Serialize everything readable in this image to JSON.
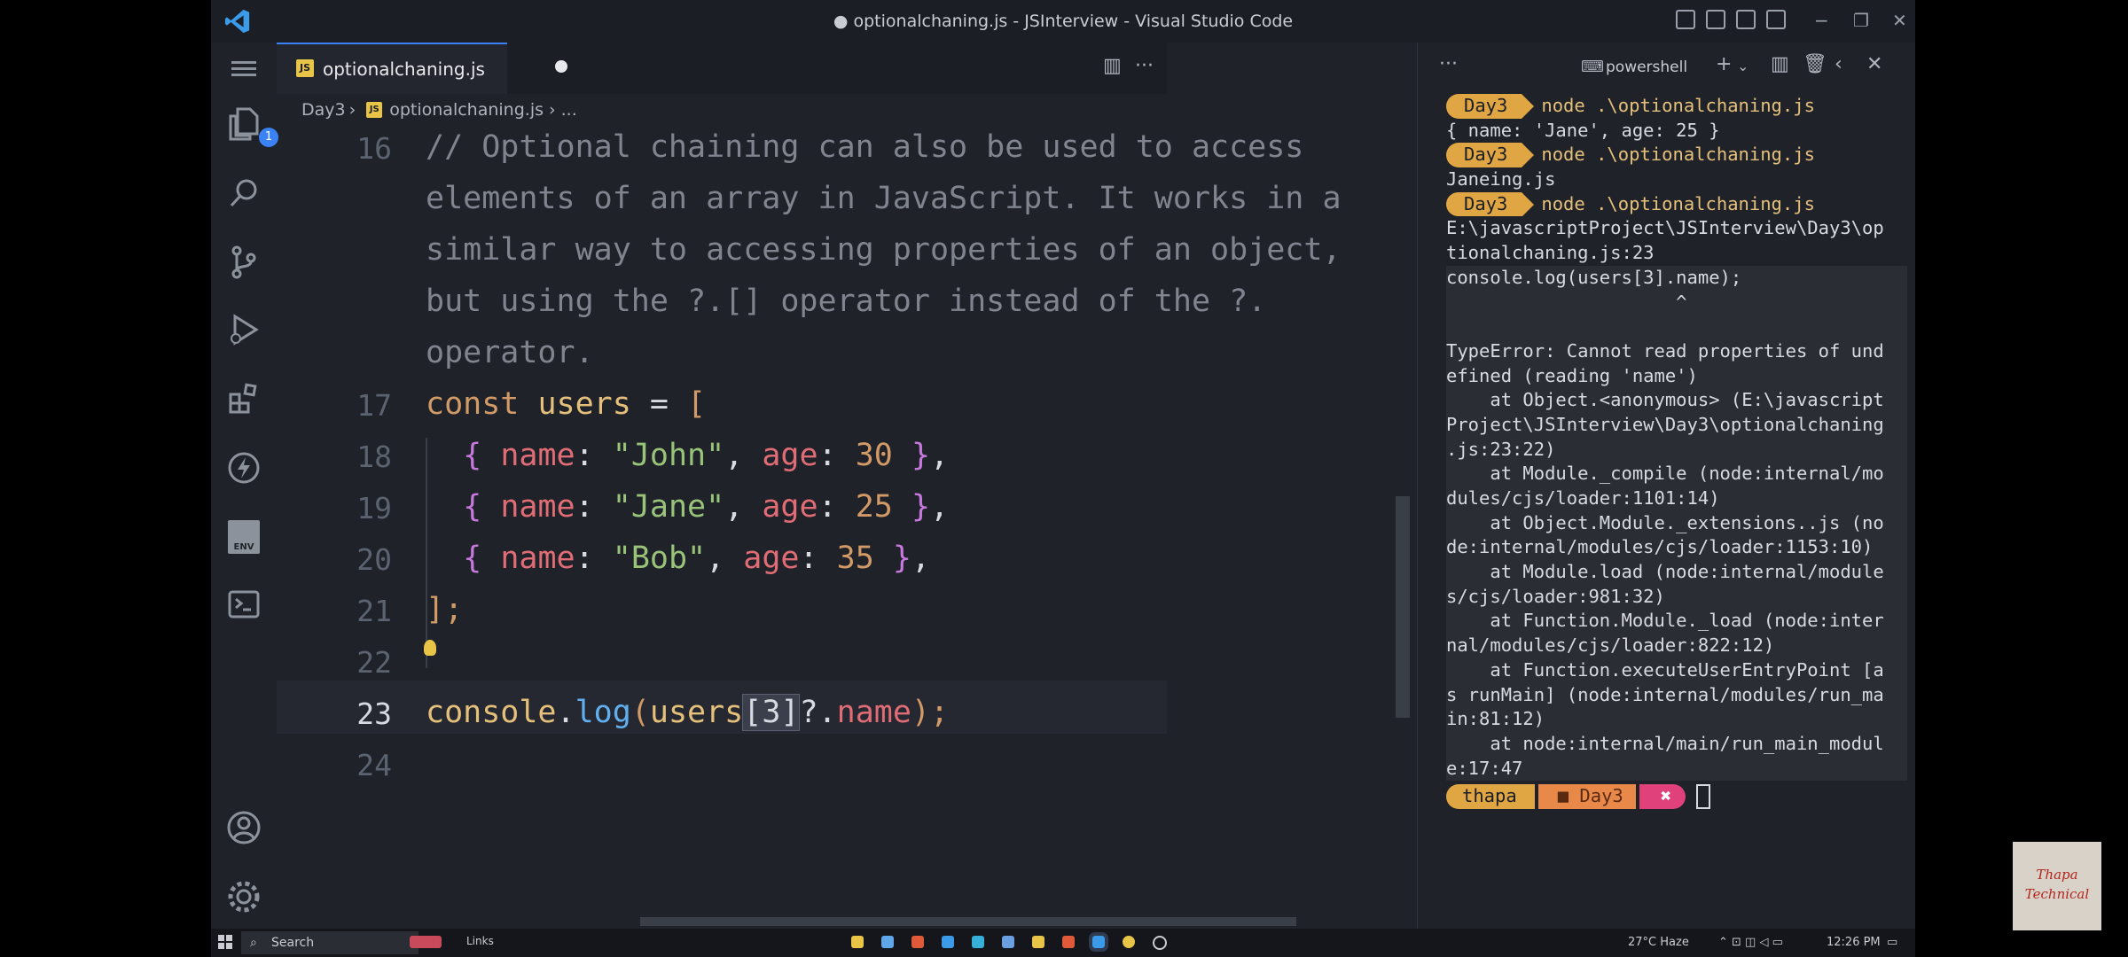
{
  "window": {
    "title": "● optionalchaning.js - JSInterview - Visual Studio Code"
  },
  "activity_bar": {
    "explorer_badge": "1",
    "env_label": "ENV"
  },
  "editor": {
    "tab_label": "optionalchaning.js",
    "breadcrumb": {
      "folder": "Day3",
      "file": "optionalchaning.js",
      "more": "..."
    },
    "line_numbers": [
      "16",
      "17",
      "18",
      "19",
      "20",
      "21",
      "22",
      "23",
      "24"
    ],
    "comment_lines": [
      "// Optional chaining can also be used to access",
      "elements of an array in JavaScript. It works in a",
      "similar way to accessing properties of an object,",
      "but using the ?.[] operator instead of the ?.",
      "operator."
    ],
    "code": {
      "const_kw": "const",
      "users_var": "users",
      "assign": " = ",
      "open_bracket": "[",
      "rows": [
        {
          "name_key": "name",
          "name_val": "\"John\"",
          "age_key": "age",
          "age_val": "30"
        },
        {
          "name_key": "name",
          "name_val": "\"Jane\"",
          "age_key": "age",
          "age_val": "25"
        },
        {
          "name_key": "name",
          "name_val": "\"Bob\"",
          "age_key": "age",
          "age_val": "35"
        }
      ],
      "close_bracket": "];",
      "l23_console": "console",
      "l23_dot": ".",
      "l23_log": "log",
      "l23_paren": "(",
      "l23_users": "users",
      "l23_index": "[3]",
      "l23_opt": "?.",
      "l23_name": "name",
      "l23_end": ");"
    }
  },
  "terminal": {
    "shell_label": "powershell",
    "lines": [
      {
        "prompt": "Day3",
        "text": "node .\\optionalchaning.js"
      },
      {
        "text": "{ name: 'Jane', age: 25 }"
      },
      {
        "prompt": "Day3",
        "text": "node .\\optionalchaning.js"
      },
      {
        "text": "Janeing.js"
      },
      {
        "prompt": "Day3",
        "text": "node .\\optionalchaning.js"
      },
      {
        "text": "E:\\javascriptProject\\JSInterview\\Day3\\op"
      },
      {
        "text": "tionalchaning.js:23"
      },
      {
        "text": "console.log(users[3].name);"
      },
      {
        "text": "                     ^"
      },
      {
        "text": ""
      },
      {
        "text": "TypeError: Cannot read properties of und"
      },
      {
        "text": "efined (reading 'name')"
      },
      {
        "text": "    at Object.<anonymous> (E:\\javascript"
      },
      {
        "text": "Project\\JSInterview\\Day3\\optionalchaning"
      },
      {
        "text": ".js:23:22)"
      },
      {
        "text": "    at Module._compile (node:internal/mo"
      },
      {
        "text": "dules/cjs/loader:1101:14)"
      },
      {
        "text": "    at Object.Module._extensions..js (no"
      },
      {
        "text": "de:internal/modules/cjs/loader:1153:10)"
      },
      {
        "text": "    at Module.load (node:internal/module"
      },
      {
        "text": "s/cjs/loader:981:32)"
      },
      {
        "text": "    at Function.Module._load (node:inter"
      },
      {
        "text": "nal/modules/cjs/loader:822:12)"
      },
      {
        "text": "    at Function.executeUserEntryPoint [a"
      },
      {
        "text": "s runMain] (node:internal/modules/run_ma"
      },
      {
        "text": "in:81:12)"
      },
      {
        "text": "    at node:internal/main/run_main_modul"
      },
      {
        "text": "e:17:47"
      }
    ],
    "final_prompt": {
      "user": "thapa",
      "folder": "Day3",
      "status": "✖"
    }
  },
  "taskbar": {
    "search_label": "Search",
    "links_label": "Links",
    "weather": "27°C Haze",
    "time": "12:26 PM"
  },
  "watermark": {
    "line1": "Thapa",
    "line2": "Technical"
  },
  "colors": {
    "accent": "#3b82f6",
    "prompt_yellow": "#e0a644",
    "prompt_orange": "#e8894a",
    "prompt_error": "#e0417a"
  }
}
